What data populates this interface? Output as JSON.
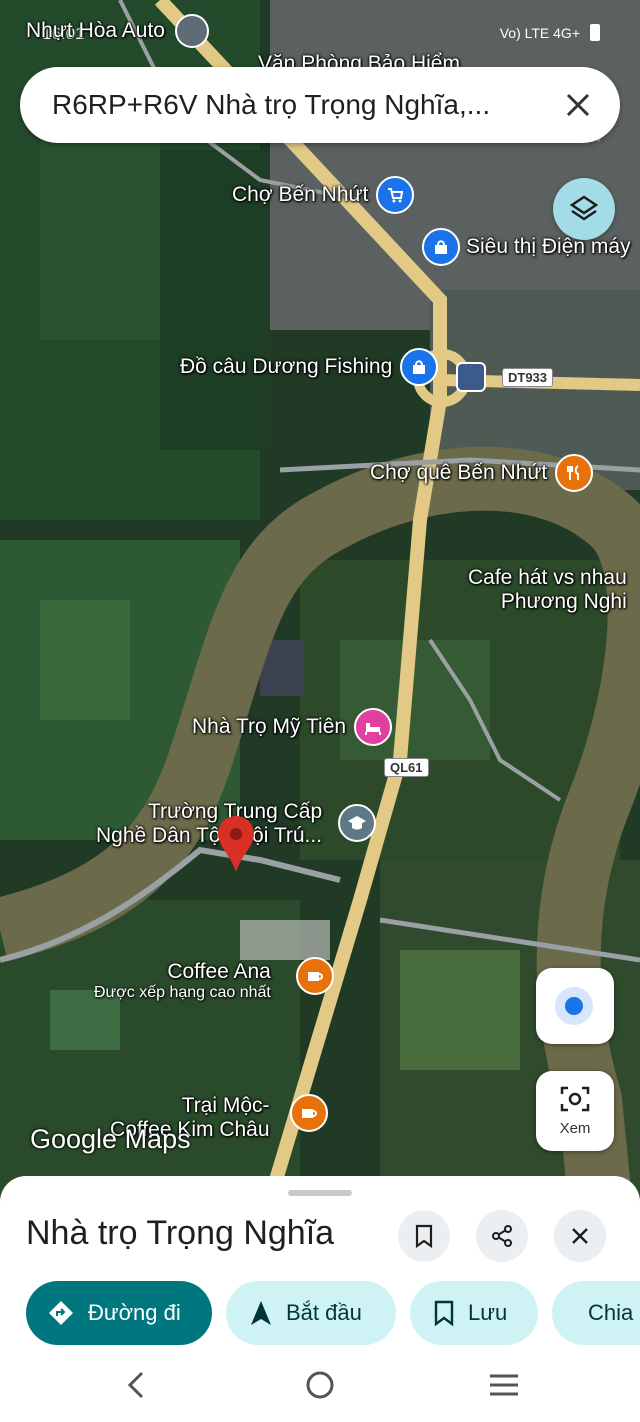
{
  "status_bar": {
    "time": "16:01",
    "network": "Vo) LTE 4G+"
  },
  "search": {
    "query": "R6RP+R6V Nhà trọ Trọng Nghĩa,..."
  },
  "map_labels": {
    "top_poi": "Nhựt Hòa Auto",
    "top_poi2": "Văn Phòng Bảo Hiểm",
    "market": "Chợ Bến Nhứt",
    "supermarket": "Siêu thị Điện máy",
    "fishing": "Đồ câu Dương Fishing",
    "road_dt": "DT933",
    "rural_market": "Chợ quê Bến Nhứt",
    "cafe_line1": "Cafe hát vs nhau",
    "cafe_line2": "Phương Nghi",
    "motel": "Nhà Trọ Mỹ Tiên",
    "road_ql": "QL61",
    "school_line1": "Trường Trung Cấp",
    "school_line2": "Nghề Dân Tộc Nội Trú...",
    "coffee_ana": "Coffee Ana",
    "coffee_ana_sub": "Được xếp hạng cao nhất",
    "trai_moc_line1": "Trại Mộc-",
    "trai_moc_line2": "Coffee Kim Châu",
    "logo": "Google Maps"
  },
  "lens_label": "Xem",
  "place": {
    "title": "Nhà trọ Trọng Nghĩa"
  },
  "actions": {
    "directions": "Đường đi",
    "start": "Bắt đầu",
    "save": "Lưu",
    "share": "Chia sẻ"
  },
  "colors": {
    "primary": "#00777f",
    "chip": "#cff3f5",
    "pin": "#d93025"
  }
}
